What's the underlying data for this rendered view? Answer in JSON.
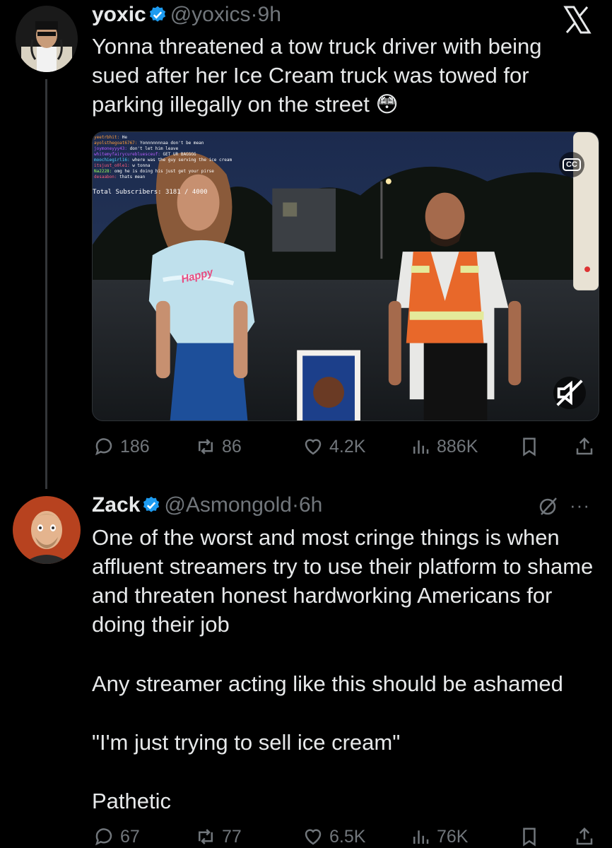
{
  "colors": {
    "background": "#000000",
    "text": "#e7e9ea",
    "muted": "#71767b",
    "verified": "#1d9bf0"
  },
  "top_bar": {
    "icon": "x-logo-icon"
  },
  "tweet1": {
    "author_name": "yoxic",
    "handle": "@yoxics",
    "separator": "·",
    "time": "9h",
    "text": "Yonna threatened a tow truck driver with being sued after her Ice Cream truck was towed for parking illegally on the street",
    "emoji": "😳",
    "media": {
      "chat_lines": [
        {
          "user": "yeetrbhit:",
          "msg": "He"
        },
        {
          "user": "ayolsthegoat6767:",
          "msg": "Yonnnnnnnaa don't be mean"
        },
        {
          "user": "joymoneyyy43:",
          "msg": "don't let him leave"
        },
        {
          "user": "whitemyfairycurebluesceuf:",
          "msg": "GET UR BAGGGG"
        },
        {
          "user": "moochiegirl16:",
          "msg": "where was the guy serving the ice cream"
        },
        {
          "user": "itsjust_o0le1:",
          "msg": "w tonna"
        },
        {
          "user": "Na2228:",
          "msg": "omg he is doing his  just get your pirse"
        },
        {
          "user": "desaabon:",
          "msg": "thats mean"
        }
      ],
      "shirt_text": "Happy",
      "subscribers": "Total Subscribers: 3181 / 4000",
      "cc_label": "CC"
    },
    "stats": {
      "replies": "186",
      "reposts": "86",
      "likes": "4.2K",
      "views": "886K"
    }
  },
  "tweet2": {
    "author_name": "Zack",
    "handle": "@Asmongold",
    "separator": "·",
    "time": "6h",
    "more": "···",
    "paragraphs": [
      "One of the worst and most cringe things is when affluent streamers try to use their platform to shame and threaten honest hardworking Americans for doing their job",
      "Any streamer acting like this should be ashamed",
      "\"I'm just trying to sell ice cream\"",
      "Pathetic"
    ],
    "stats": {
      "replies": "67",
      "reposts": "77",
      "likes": "6.5K",
      "views": "76K"
    }
  }
}
